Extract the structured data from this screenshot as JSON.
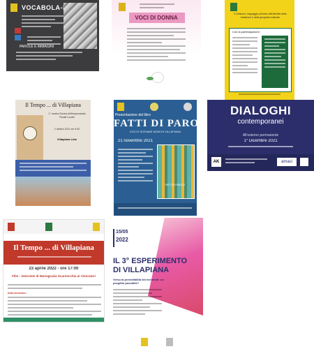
{
  "posters": [
    {
      "title": "VOCABOLA-IO",
      "sub": "PAROLE E IMMAGINI"
    },
    {
      "title": "VOCI DI DONNA"
    },
    {
      "title": "Il Gelsomo: linguaggio primario dell'identità della tradizione e della geografia culturale",
      "heading": "Con la partecipazione:"
    },
    {
      "title": "Il Tempo ... di Villapiana",
      "sub": "1° mostra Storica dell'Impresariato Rurale Locale",
      "date": "2 ottobre 2021 ore 9:30",
      "place": "Villapiana Lido"
    },
    {
      "overtitle": "Presentazione del libro",
      "title": "FATTI DI PAROLE",
      "sub": "VOCI E SCENARI NOMI DI VILLAPIANA",
      "date": "21 novembre 2021",
      "book_title": "FATTI DI PAROLE"
    },
    {
      "title": "DIALOGHI",
      "title2": "contemporanei",
      "sub": "All'esterno permanente",
      "date": "1° Dicembre 2021",
      "logos": [
        "AK",
        "amaci"
      ]
    },
    {
      "title": "Il Tempo ... di Villapiana",
      "date": "23 aprile 2022 - ore 17:00",
      "section": "Film - interviste di Mariagrazia Scarnecchia ai ristoratori",
      "heading": "Interverranno:"
    },
    {
      "badge_date": "15/05",
      "badge_year": "2022",
      "title": "IL 3° ESPERIMENTO",
      "title2": "DI VILLAPIANA",
      "sub": "Verso la prevedibilità dei terremoti: un progetto possibile?"
    }
  ],
  "colors": {
    "navy": "#2b2e6a",
    "yellow": "#f3d21a",
    "red": "#c0392b",
    "green": "#2f8f66",
    "pink": "#e85aa6"
  }
}
